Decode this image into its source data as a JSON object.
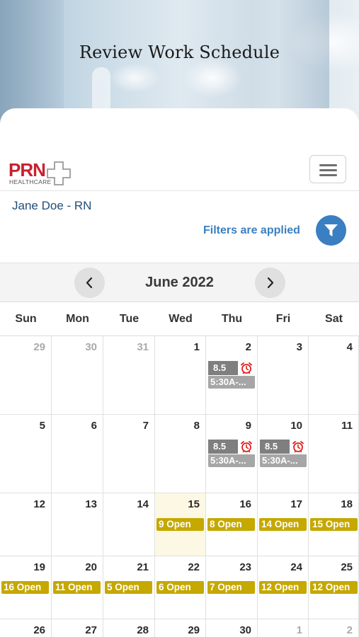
{
  "hero": {
    "title": "Review Work Schedule"
  },
  "header": {
    "logo_text": "PRN",
    "logo_subtext": "HEALTHCARE",
    "brand_color": "#c8212f",
    "menu_icon": "hamburger-menu-icon"
  },
  "user": {
    "name": "Jane Doe - RN"
  },
  "filters": {
    "label": "Filters are applied",
    "icon": "filter-funnel-icon",
    "color": "#3a7fc1"
  },
  "calendar": {
    "month_label": "June 2022",
    "prev_icon": "chevron-left-icon",
    "next_icon": "chevron-right-icon",
    "weekdays": [
      "Sun",
      "Mon",
      "Tue",
      "Wed",
      "Thu",
      "Fri",
      "Sat"
    ],
    "weeks": [
      [
        {
          "day": "29",
          "other": true
        },
        {
          "day": "30",
          "other": true
        },
        {
          "day": "31",
          "other": true
        },
        {
          "day": "1"
        },
        {
          "day": "2",
          "shift": {
            "hours": "8.5",
            "time": "5:30A-..."
          }
        },
        {
          "day": "3"
        },
        {
          "day": "4"
        }
      ],
      [
        {
          "day": "5"
        },
        {
          "day": "6"
        },
        {
          "day": "7"
        },
        {
          "day": "8"
        },
        {
          "day": "9",
          "shift": {
            "hours": "8.5",
            "time": "5:30A-..."
          }
        },
        {
          "day": "10",
          "shift": {
            "hours": "8.5",
            "time": "5:30A-..."
          }
        },
        {
          "day": "11"
        }
      ],
      [
        {
          "day": "12"
        },
        {
          "day": "13"
        },
        {
          "day": "14"
        },
        {
          "day": "15",
          "today": true,
          "open": "9 Open"
        },
        {
          "day": "16",
          "open": "8 Open"
        },
        {
          "day": "17",
          "open": "14 Open"
        },
        {
          "day": "18",
          "open": "15 Open"
        }
      ],
      [
        {
          "day": "19",
          "open": "16 Open"
        },
        {
          "day": "20",
          "open": "11 Open"
        },
        {
          "day": "21",
          "open": "5 Open"
        },
        {
          "day": "22",
          "open": "6 Open"
        },
        {
          "day": "23",
          "open": "7 Open"
        },
        {
          "day": "24",
          "open": "12 Open"
        },
        {
          "day": "25",
          "open": "12 Open"
        }
      ],
      [
        {
          "day": "26"
        },
        {
          "day": "27"
        },
        {
          "day": "28"
        },
        {
          "day": "29"
        },
        {
          "day": "30"
        },
        {
          "day": "1",
          "other": true
        },
        {
          "day": "2",
          "other": true
        }
      ]
    ],
    "colors": {
      "open_badge": "#c5a800",
      "shift_hours": "#7f7f7f",
      "shift_time": "#a6a6a6",
      "today": "#fcf8e3",
      "alarm": "#e02020"
    }
  }
}
